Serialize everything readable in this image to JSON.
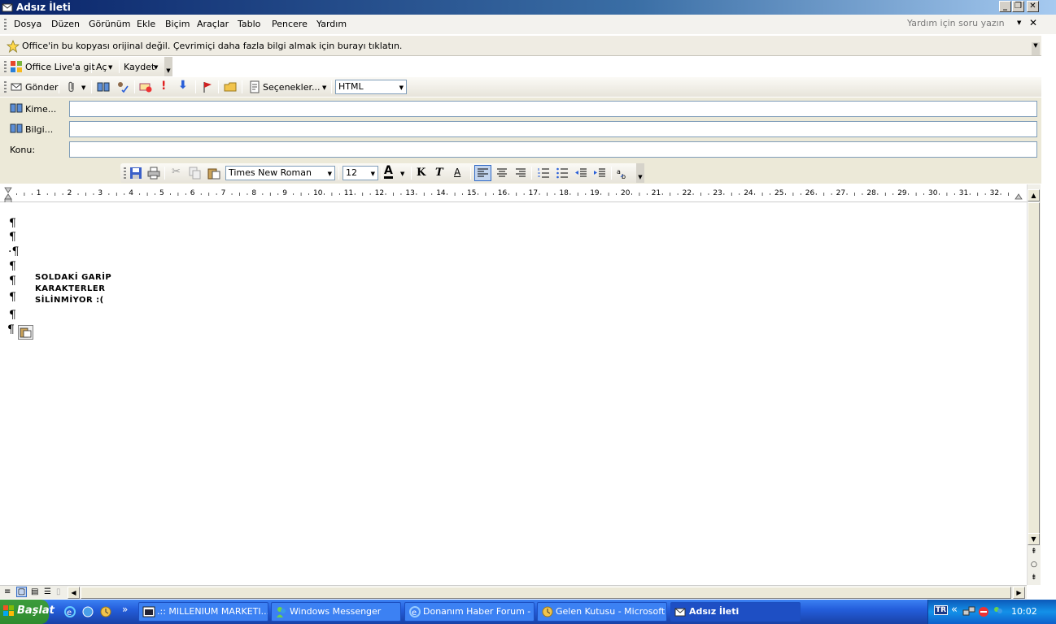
{
  "window": {
    "title": "Adsız İleti"
  },
  "menubar": {
    "items": [
      "Dosya",
      "Düzen",
      "Görünüm",
      "Ekle",
      "Biçim",
      "Araçlar",
      "Tablo",
      "Pencere",
      "Yardım"
    ],
    "help_placeholder": "Yardım için soru yazın"
  },
  "warning": {
    "text": "Office'in bu kopyası orijinal değil. Çevrimiçi daha fazla bilgi almak için burayı tıklatın."
  },
  "office_toolbar": {
    "live": "Office Live'a git",
    "open": "Aç",
    "save": "Kaydet"
  },
  "send_toolbar": {
    "send": "Gönder",
    "options": "Seçenekler...",
    "format": "HTML"
  },
  "headers": {
    "to_label": "Kime...",
    "cc_label": "Bilgi...",
    "subject_label": "Konu:",
    "to_value": "",
    "cc_value": "",
    "subject_value": ""
  },
  "format_toolbar": {
    "font": "Times New Roman",
    "size": "12",
    "bold": "K",
    "italic": "T",
    "underline": "A"
  },
  "ruler": {
    "numbers": [
      "1",
      "2",
      "3",
      "4",
      "5",
      "6",
      "7",
      "8",
      "9",
      "10",
      "11",
      "12",
      "13",
      "14",
      "15",
      "16",
      "17",
      "18",
      "19",
      "20",
      "21",
      "22",
      "23",
      "24",
      "25",
      "26",
      "27",
      "28",
      "29",
      "30",
      "31",
      "32"
    ]
  },
  "document": {
    "marks": [
      "¶",
      "¶",
      "·¶",
      "¶",
      "¶",
      "¶",
      "¶",
      "¶"
    ],
    "lines": [
      "SOLDAKİ GARİP",
      "KARAKTERLER",
      "SİLİNMİYOR :("
    ]
  },
  "taskbar": {
    "start": "Başlat",
    "windows": [
      {
        "label": ".:: MILLENIUM MARKETI...",
        "active": false
      },
      {
        "label": "Windows Messenger",
        "active": false
      },
      {
        "label": "Donanım Haber Forum - ...",
        "active": false
      },
      {
        "label": "Gelen Kutusu - Microsoft ...",
        "active": false
      },
      {
        "label": "Adsız İleti",
        "active": true
      }
    ],
    "lang": "TR",
    "clock": "10:02"
  }
}
